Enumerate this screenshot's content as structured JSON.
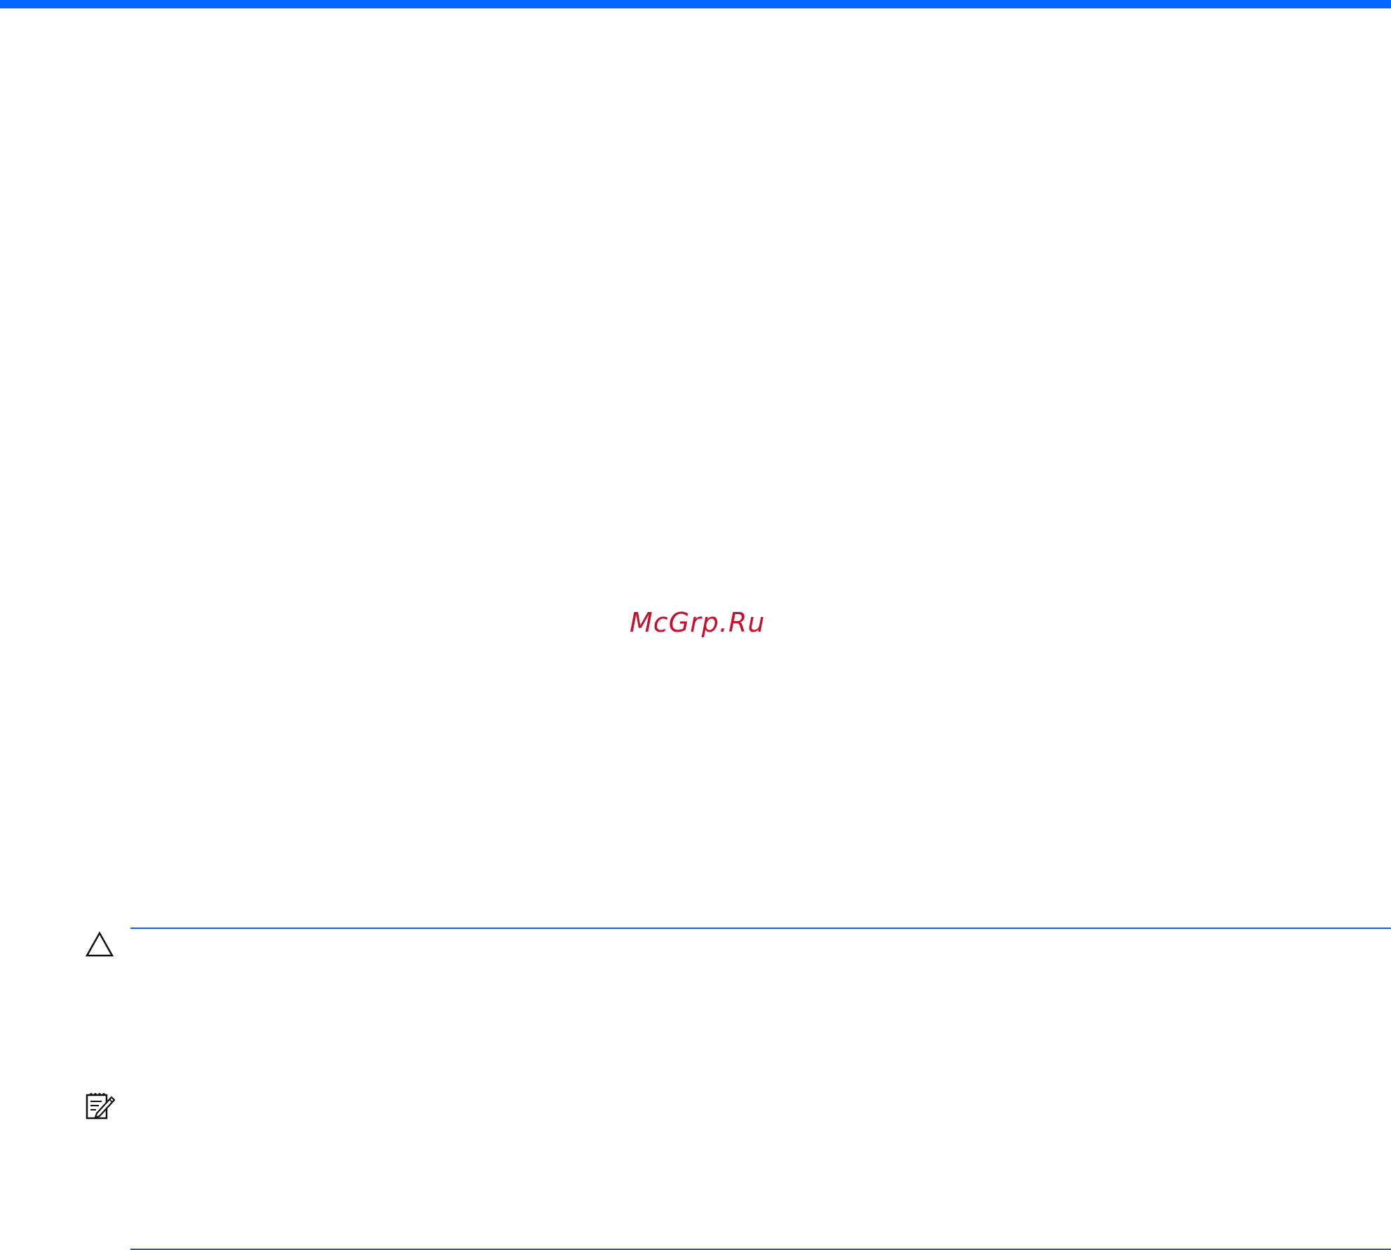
{
  "page": {
    "accent_color": "#0066ff",
    "rule_color": "#1560d4"
  },
  "watermark": {
    "text": "McGrp.Ru",
    "color": "#c8102e"
  },
  "notices": [
    {
      "icon": "caution-icon"
    },
    {
      "icon": "note-icon"
    }
  ]
}
